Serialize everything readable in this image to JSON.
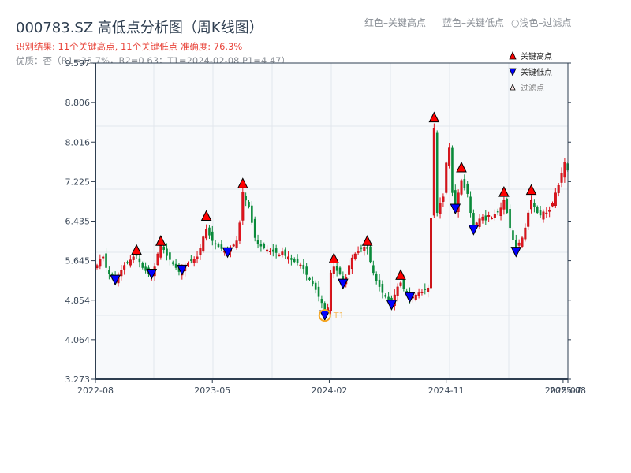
{
  "header": {
    "title": "000783.SZ 高低点分析图（周K线图）",
    "result": "识别结果: 11个关键高点, 11个关键低点  准确度: 76.3%",
    "quality": "优质：否（R1=35.7%，R2=0.63；T1=2024-02-08 P1=4.47）",
    "legend_high": "红色–关键高点",
    "legend_low": "蓝色–关键低点",
    "legend_filtered": "○浅色–过滤点"
  },
  "chart_data": {
    "type": "candlestick",
    "frequency": "weekly",
    "ylim": [
      3.273,
      9.597
    ],
    "y_ticks": [
      "3.273",
      "4.064",
      "4.854",
      "5.645",
      "6.435",
      "7.225",
      "8.016",
      "8.806",
      "9.597"
    ],
    "x_ticks": [
      {
        "label": "2022-08",
        "index": 0
      },
      {
        "label": "2023-05",
        "index": 38.5
      },
      {
        "label": "2024-02",
        "index": 77
      },
      {
        "label": "2024-11",
        "index": 115.5
      },
      {
        "label": "2025-07",
        "index": 154
      },
      {
        "label": "2025-08",
        "index": 155.8
      }
    ],
    "grid": true,
    "colors": {
      "up": "#e0141e",
      "down": "#0a8a3a",
      "high_marker": "#ff0000",
      "low_marker": "#0000ff",
      "t1": "#f5a623",
      "axis": "#2e3e50",
      "plot_bg": "#f7f9fb"
    },
    "closes": [
      5.55,
      5.68,
      5.72,
      5.5,
      5.38,
      5.3,
      5.26,
      5.36,
      5.45,
      5.55,
      5.6,
      5.66,
      5.72,
      5.76,
      5.62,
      5.5,
      5.44,
      5.38,
      5.34,
      5.52,
      5.78,
      5.95,
      5.86,
      5.74,
      5.66,
      5.58,
      5.5,
      5.42,
      5.46,
      5.52,
      5.6,
      5.64,
      5.68,
      5.72,
      5.9,
      6.12,
      6.28,
      6.15,
      6.04,
      5.98,
      5.92,
      5.88,
      5.84,
      5.8,
      5.88,
      5.96,
      6.04,
      6.4,
      7.02,
      6.85,
      6.72,
      6.4,
      6.1,
      5.98,
      5.93,
      5.9,
      5.86,
      5.84,
      5.82,
      5.8,
      5.76,
      5.82,
      5.74,
      5.72,
      5.66,
      5.62,
      5.6,
      5.56,
      5.48,
      5.36,
      5.26,
      5.18,
      5.06,
      4.92,
      4.8,
      4.62,
      4.7,
      5.4,
      5.52,
      5.44,
      5.38,
      5.18,
      5.32,
      5.55,
      5.7,
      5.78,
      5.84,
      5.88,
      5.92,
      5.88,
      5.62,
      5.4,
      5.24,
      5.12,
      5.0,
      4.92,
      4.86,
      4.8,
      4.96,
      5.12,
      5.2,
      5.08,
      5.0,
      4.88,
      4.92,
      4.96,
      5.0,
      5.02,
      5.06,
      5.1,
      6.5,
      8.3,
      6.6,
      6.8,
      6.92,
      7.6,
      7.9,
      7.0,
      6.7,
      7.0,
      7.25,
      7.1,
      6.98,
      6.6,
      6.3,
      6.4,
      6.48,
      6.52,
      6.45,
      6.55,
      6.5,
      6.58,
      6.62,
      6.7,
      6.85,
      6.6,
      6.3,
      6.05,
      5.9,
      6.0,
      6.1,
      6.3,
      6.6,
      6.85,
      6.72,
      6.6,
      6.55,
      6.62,
      6.6,
      6.66,
      6.8,
      7.0,
      7.15,
      7.4,
      7.62,
      7.45
    ],
    "key_highs": [
      {
        "index": 13,
        "price": 5.77
      },
      {
        "index": 21,
        "price": 5.95
      },
      {
        "index": 36,
        "price": 6.45
      },
      {
        "index": 48,
        "price": 7.1
      },
      {
        "index": 78,
        "price": 5.6
      },
      {
        "index": 89,
        "price": 5.95
      },
      {
        "index": 100,
        "price": 5.27
      },
      {
        "index": 111,
        "price": 8.42
      },
      {
        "index": 120,
        "price": 7.42
      },
      {
        "index": 134,
        "price": 6.93
      },
      {
        "index": 143,
        "price": 6.97
      }
    ],
    "key_lows": [
      {
        "index": 6,
        "price": 5.18
      },
      {
        "index": 18,
        "price": 5.3
      },
      {
        "index": 28,
        "price": 5.38
      },
      {
        "index": 43,
        "price": 5.73
      },
      {
        "index": 75,
        "price": 4.47
      },
      {
        "index": 81,
        "price": 5.1
      },
      {
        "index": 97,
        "price": 4.68
      },
      {
        "index": 103,
        "price": 4.83
      },
      {
        "index": 118,
        "price": 6.6
      },
      {
        "index": 124,
        "price": 6.18
      },
      {
        "index": 138,
        "price": 5.74
      }
    ],
    "t1": {
      "label": "T1",
      "index": 75,
      "price": 4.47
    },
    "legend": {
      "high": "关键高点",
      "low": "关键低点",
      "filtered": "过滤点",
      "placement": "top-right"
    }
  }
}
